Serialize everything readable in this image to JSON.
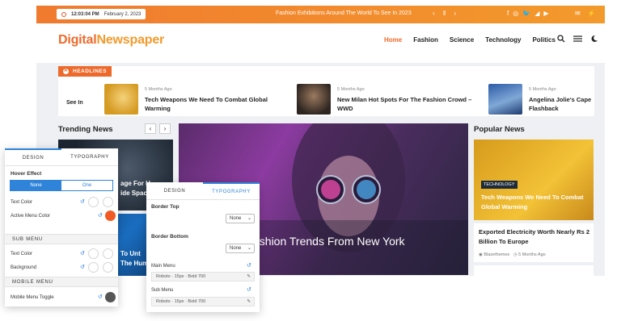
{
  "topbar": {
    "time": "12:03:04 PM",
    "date": "February 2, 2023",
    "ticker": "Fashion Exhibitions Around The World To See In 2023",
    "ticker_nav": "‹ ‖ ›",
    "socials": [
      "f",
      "◎",
      "🐦",
      "◢",
      "▶"
    ],
    "utils": [
      "✉",
      "⚡"
    ]
  },
  "header": {
    "logo_part1": "Digital",
    "logo_part2": "Newspaper",
    "nav": [
      "Home",
      "Fashion",
      "Science",
      "Technology",
      "Politics"
    ],
    "icons": [
      "search-icon",
      "menu-icon",
      "dark-mode-icon"
    ]
  },
  "headlines": {
    "badge": "HEADLINES",
    "fragment": "See In",
    "items": [
      {
        "meta": "5 Months Ago",
        "title": "Tech Weapons We Need To Combat Global Warming"
      },
      {
        "meta": "5 Months Ago",
        "title": "New Milan Hot Spots For The Fashion Crowd – WWD"
      },
      {
        "meta": "5 Months Ago",
        "title": "Angelina Jolie's Cape Flashback"
      }
    ]
  },
  "trending": {
    "title": "Trending News",
    "prev": "‹",
    "next": "›",
    "text1": "age For H",
    "text1b": "ide Spac",
    "text2": "To Unt",
    "text2b": "The Hum"
  },
  "hero": {
    "title": "ashion Trends From New York"
  },
  "popular": {
    "title": "Popular News",
    "card_category": "TECHNOLOGY",
    "card_title": "Tech Weapons We Need To Combat Global Warming",
    "item_title": "Exported Electricity Worth Nearly Rs 2 Billion To Europe",
    "item_meta": "Blazethemes",
    "item_date": "5 Months Ago"
  },
  "panel_left": {
    "tab_design": "DESIGN",
    "tab_typography": "TYPOGRAPHY",
    "hover_effect": "Hover Effect",
    "hover_none": "None",
    "hover_one": "One",
    "text_color": "Text Color",
    "active_menu_color": "Active Menu Color",
    "sub_menu": "SUB MENU",
    "sub_text_color": "Text Color",
    "background": "Background",
    "mobile_menu": "MOBILE MENU",
    "mobile_toggle": "Mobile Menu Toggle",
    "active_color": "#f05a24",
    "toggle_color": "#555555"
  },
  "panel_right": {
    "tab_design": "DESIGN",
    "tab_typography": "TYPOGRAPHY",
    "border_top": "Border Top",
    "border_top_value": "None",
    "border_bottom": "Border Bottom",
    "border_bottom_value": "None",
    "main_menu": "Main Menu",
    "main_menu_font": "Roboto  ·  15px  ·  Bold 700",
    "sub_menu": "Sub Menu",
    "sub_menu_font": "Roboto  ·  15px  ·  Bold 700"
  }
}
